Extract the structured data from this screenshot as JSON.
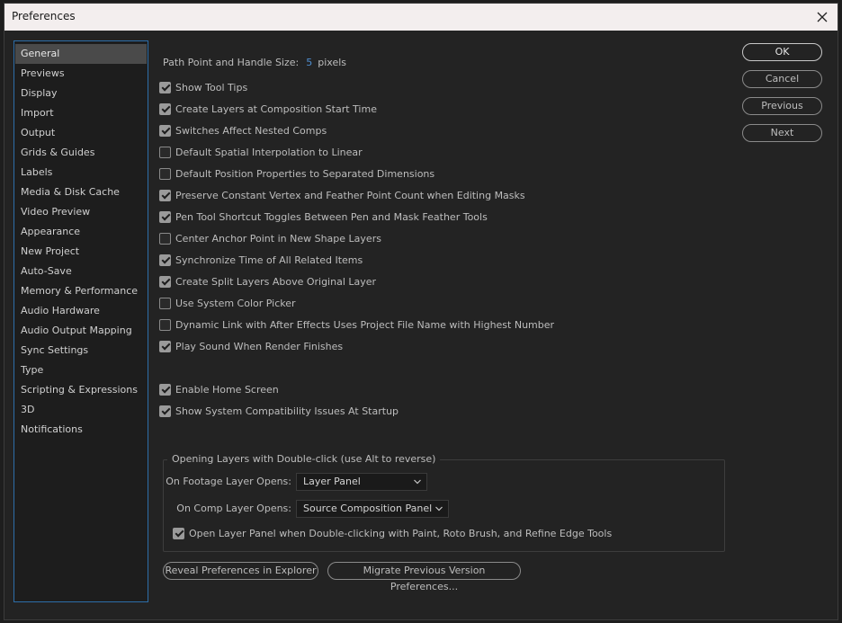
{
  "window": {
    "title": "Preferences"
  },
  "sidebar": {
    "items": [
      {
        "label": "General",
        "selected": true
      },
      {
        "label": "Previews"
      },
      {
        "label": "Display"
      },
      {
        "label": "Import"
      },
      {
        "label": "Output"
      },
      {
        "label": "Grids & Guides"
      },
      {
        "label": "Labels"
      },
      {
        "label": "Media & Disk Cache"
      },
      {
        "label": "Video Preview"
      },
      {
        "label": "Appearance"
      },
      {
        "label": "New Project"
      },
      {
        "label": "Auto-Save"
      },
      {
        "label": "Memory & Performance"
      },
      {
        "label": "Audio Hardware"
      },
      {
        "label": "Audio Output Mapping"
      },
      {
        "label": "Sync Settings"
      },
      {
        "label": "Type"
      },
      {
        "label": "Scripting & Expressions"
      },
      {
        "label": "3D"
      },
      {
        "label": "Notifications"
      }
    ]
  },
  "path_point": {
    "label": "Path Point and Handle Size:",
    "value": "5",
    "unit": "pixels"
  },
  "checkboxes": [
    {
      "label": "Show Tool Tips",
      "checked": true
    },
    {
      "label": "Create Layers at Composition Start Time",
      "checked": true
    },
    {
      "label": "Switches Affect Nested Comps",
      "checked": true
    },
    {
      "label": "Default Spatial Interpolation to Linear",
      "checked": false
    },
    {
      "label": "Default Position Properties to Separated Dimensions",
      "checked": false
    },
    {
      "label": "Preserve Constant Vertex and Feather Point Count when Editing Masks",
      "checked": true
    },
    {
      "label": "Pen Tool Shortcut Toggles Between Pen and Mask Feather Tools",
      "checked": true
    },
    {
      "label": "Center Anchor Point in New Shape Layers",
      "checked": false
    },
    {
      "label": "Synchronize Time of All Related Items",
      "checked": true
    },
    {
      "label": "Create Split Layers Above Original Layer",
      "checked": true
    },
    {
      "label": "Use System Color Picker",
      "checked": false
    },
    {
      "label": "Dynamic Link with After Effects Uses Project File Name with Highest Number",
      "checked": false
    },
    {
      "label": "Play Sound When Render Finishes",
      "checked": true
    }
  ],
  "startup_checkboxes": [
    {
      "label": "Enable Home Screen",
      "checked": true
    },
    {
      "label": "Show System Compatibility Issues At Startup",
      "checked": true
    }
  ],
  "buttons": {
    "ok": "OK",
    "cancel": "Cancel",
    "previous": "Previous",
    "next": "Next"
  },
  "double_click_group": {
    "legend": "Opening Layers with Double-click (use Alt to reverse)",
    "footage_label": "On Footage Layer Opens:",
    "footage_value": "Layer Panel",
    "comp_label": "On Comp Layer Opens:",
    "comp_value": "Source Composition Panel",
    "open_layer_panel": {
      "label": "Open Layer Panel when Double-clicking with Paint, Roto Brush, and Refine Edge Tools",
      "checked": true
    }
  },
  "bottom_buttons": {
    "reveal": "Reveal Preferences in Explorer",
    "migrate": "Migrate Previous Version Preferences..."
  }
}
